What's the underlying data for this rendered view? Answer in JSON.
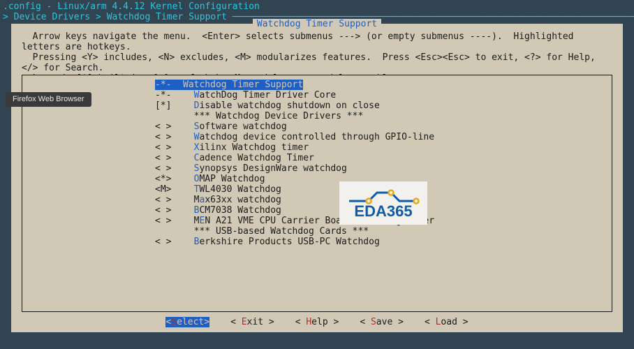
{
  "topbar": {
    "line1": ".config - Linux/arm 4.4.12 Kernel Configuration",
    "line2": "> Device Drivers > Watchdog Timer Support"
  },
  "title": "Watchdog Timer Support",
  "help": "  Arrow keys navigate the menu.  <Enter> selects submenus ---> (or empty submenus ----).  Highlighted letters are hotkeys.\n  Pressing <Y> includes, <N> excludes, <M> modularizes features.  Press <Esc><Esc> to exit, <?> for Help, </> for Search.\n  Legend: [*] built-in  [ ] excluded  <M> module  < > module capable",
  "menu": [
    {
      "sym": "-*-",
      "pre": "",
      "hk": "",
      "post": "Watchdog Timer Support",
      "sel": true,
      "indent": 0
    },
    {
      "sym": "-*-",
      "pre": "  ",
      "hk": "W",
      "post": "atchDog Timer Driver Core",
      "indent": 0
    },
    {
      "sym": "[*]",
      "pre": "  ",
      "hk": "D",
      "post": "isable watchdog shutdown on close",
      "indent": 0
    },
    {
      "sym": "   ",
      "pre": "  *** Watchdog Device Drivers ***",
      "hk": "",
      "post": "",
      "indent": 0
    },
    {
      "sym": "< >",
      "pre": "  ",
      "hk": "S",
      "post": "oftware watchdog",
      "indent": 0
    },
    {
      "sym": "< >",
      "pre": "  ",
      "hk": "W",
      "post": "atchdog device controlled through GPIO-line",
      "indent": 0
    },
    {
      "sym": "< >",
      "pre": "  ",
      "hk": "X",
      "post": "ilinx Watchdog timer",
      "indent": 0
    },
    {
      "sym": "< >",
      "pre": "  ",
      "hk": "C",
      "post": "adence Watchdog Timer",
      "indent": 0
    },
    {
      "sym": "< >",
      "pre": "  ",
      "hk": "S",
      "post": "ynopsys DesignWare watchdog",
      "indent": 0
    },
    {
      "sym": "<*>",
      "pre": "  ",
      "hk": "O",
      "post": "MAP Watchdog",
      "indent": 0
    },
    {
      "sym": "<M>",
      "pre": "  ",
      "hk": "T",
      "post": "WL4030 Watchdog",
      "indent": 0
    },
    {
      "sym": "< >",
      "pre": "  M",
      "hk": "a",
      "post": "x63xx watchdog",
      "indent": 0
    },
    {
      "sym": "< >",
      "pre": "  ",
      "hk": "B",
      "post": "CM7038 Watchdog",
      "indent": 0
    },
    {
      "sym": "< >",
      "pre": "  M",
      "hk": "E",
      "post": "N A21 VME CPU Carrier Board Watchdog Timer",
      "indent": 0
    },
    {
      "sym": "   ",
      "pre": "  *** USB-based Watchdog Cards ***",
      "hk": "",
      "post": "",
      "indent": 0
    },
    {
      "sym": "< >",
      "pre": "  ",
      "hk": "B",
      "post": "erkshire Products USB-PC Watchdog",
      "indent": 0
    }
  ],
  "buttons": [
    {
      "pre": "<",
      "hk": "S",
      "post": "elect>",
      "sel": true
    },
    {
      "pre": "< ",
      "hk": "E",
      "post": "xit >"
    },
    {
      "pre": "< ",
      "hk": "H",
      "post": "elp >"
    },
    {
      "pre": "< ",
      "hk": "S",
      "post": "ave >"
    },
    {
      "pre": "< ",
      "hk": "L",
      "post": "oad >"
    }
  ],
  "tooltip": "Firefox Web Browser",
  "watermark": "EDA365"
}
